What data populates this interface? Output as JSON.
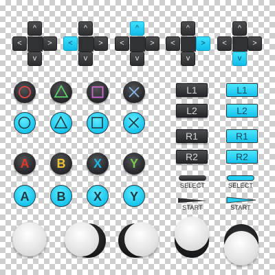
{
  "colors": {
    "accent": "#12c2ec",
    "dark": "#2c2e31",
    "stick_cap": "#e6e6e6"
  },
  "dpad_arrows": {
    "up": "^",
    "down": "v",
    "left": "<",
    "right": ">"
  },
  "dpads": [
    {
      "highlight": "none"
    },
    {
      "highlight": "left"
    },
    {
      "highlight": "up"
    },
    {
      "highlight": "right"
    },
    {
      "highlight": "down"
    }
  ],
  "playstation_symbols": [
    "circle-icon",
    "triangle-icon",
    "square-icon",
    "cross-icon"
  ],
  "letter_buttons": [
    "A",
    "B",
    "X",
    "Y"
  ],
  "letter_colors": {
    "A": "#e2382c",
    "B": "#f1c232",
    "X": "#1bb8e6",
    "Y": "#79c94a"
  },
  "shoulder_buttons": [
    "L1",
    "L2",
    "R1",
    "R2"
  ],
  "small_buttons": {
    "select": "SELECT",
    "start": "START"
  },
  "sticks": [
    {
      "state": "neutral"
    },
    {
      "state": "left"
    },
    {
      "state": "right"
    },
    {
      "state": "up"
    },
    {
      "state": "down"
    }
  ]
}
